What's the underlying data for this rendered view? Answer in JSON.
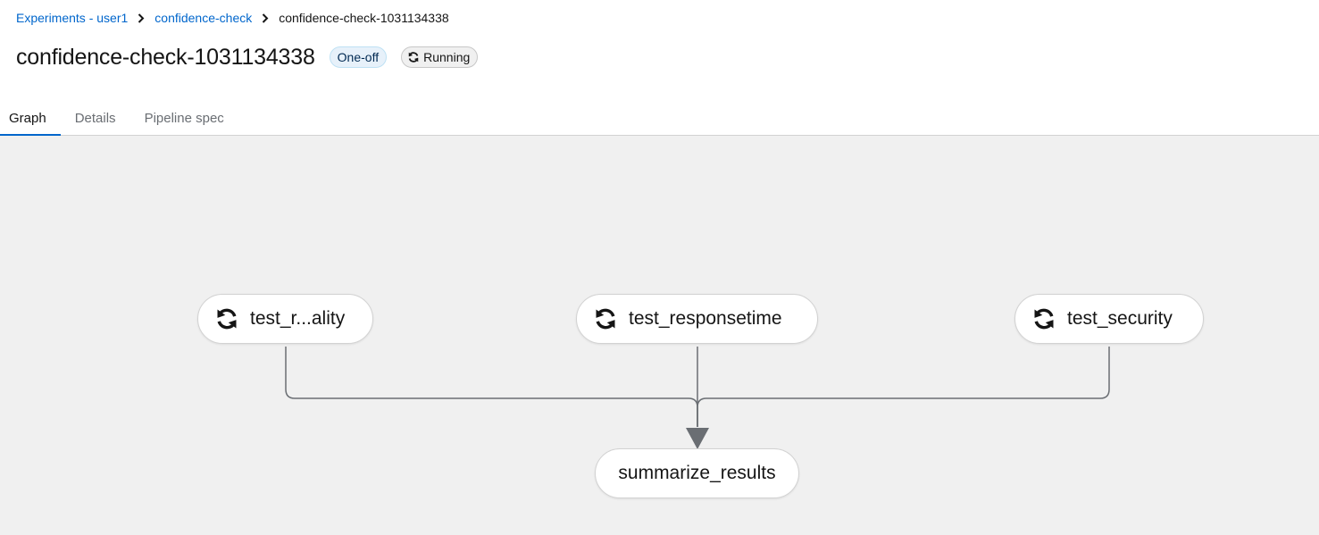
{
  "breadcrumb": {
    "experiments": "Experiments - user1",
    "pipeline": "confidence-check",
    "run": "confidence-check-1031134338"
  },
  "header": {
    "title": "confidence-check-1031134338",
    "type_badge": "One-off",
    "status_badge": "Running"
  },
  "tabs": [
    {
      "label": "Graph",
      "active": true
    },
    {
      "label": "Details",
      "active": false
    },
    {
      "label": "Pipeline spec",
      "active": false
    }
  ],
  "graph": {
    "nodes": {
      "test_quality": {
        "label": "test_r...ality",
        "status": "running",
        "icon": "sync-icon"
      },
      "test_responsetime": {
        "label": "test_responsetime",
        "status": "running",
        "icon": "sync-icon"
      },
      "test_security": {
        "label": "test_security",
        "status": "running",
        "icon": "sync-icon"
      },
      "summarize_results": {
        "label": "summarize_results",
        "status": "pending"
      }
    },
    "colors": {
      "background": "#f0f0f0",
      "edge": "#6a6e73",
      "node_border": "#d2d2d2"
    }
  },
  "colors": {
    "link": "#0066cc",
    "active_tab": "#0066cc"
  }
}
